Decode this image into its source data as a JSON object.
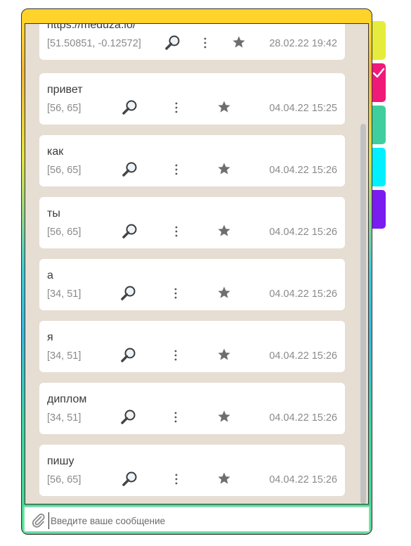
{
  "theme": {
    "tab_colors": [
      "#e6ec3c",
      "#f0197a",
      "#3fcf9f",
      "#00f0ff",
      "#7a1cf0"
    ],
    "card_bg": "#ffffff",
    "chat_bg": "#e6ddd3"
  },
  "tabs": [
    {
      "color": "#e6ec3c",
      "checked": false
    },
    {
      "color": "#f0197a",
      "checked": true
    },
    {
      "color": "#3fcf9f",
      "checked": false
    },
    {
      "color": "#00f0ff",
      "checked": false
    },
    {
      "color": "#7a1cf0",
      "checked": false
    }
  ],
  "messages": [
    {
      "text": "https://meduza.io/",
      "coords": "[51.50851, -0.12572]",
      "date": "28.02.22 19:42"
    },
    {
      "text": "привет",
      "coords": "[56, 65]",
      "date": "04.04.22 15:25"
    },
    {
      "text": "как",
      "coords": "[56, 65]",
      "date": "04.04.22 15:26"
    },
    {
      "text": "ты",
      "coords": "[56, 65]",
      "date": "04.04.22 15:26"
    },
    {
      "text": "а",
      "coords": "[34, 51]",
      "date": "04.04.22 15:26"
    },
    {
      "text": "я",
      "coords": "[34, 51]",
      "date": "04.04.22 15:26"
    },
    {
      "text": "диплом",
      "coords": "[34, 51]",
      "date": "04.04.22 15:26"
    },
    {
      "text": "пишу",
      "coords": "[56, 65]",
      "date": "04.04.22 15:26"
    }
  ],
  "composer": {
    "placeholder": "Введите ваше сообщение",
    "value": "",
    "attach_icon": "paperclip-icon"
  },
  "icons": {
    "search": "magnifier-icon",
    "more": "vertical-dots-icon",
    "favorite": "star-icon"
  }
}
